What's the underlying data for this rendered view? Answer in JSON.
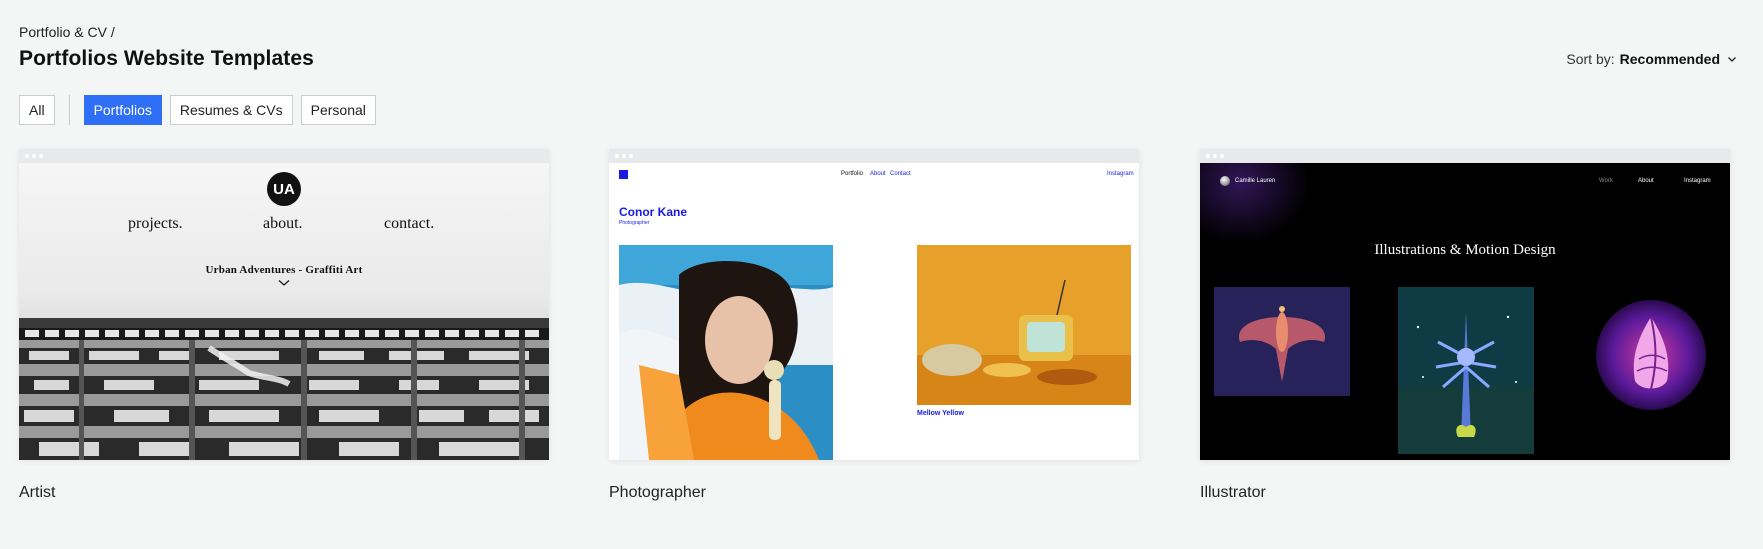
{
  "breadcrumb": {
    "parent": "Portfolio & CV",
    "separator": "/"
  },
  "page": {
    "title": "Portfolios Website Templates"
  },
  "sort": {
    "label": "Sort by:",
    "value": "Recommended"
  },
  "filters": [
    {
      "label": "All",
      "active": false
    },
    {
      "label": "Portfolios",
      "active": true
    },
    {
      "label": "Resumes & CVs",
      "active": false
    },
    {
      "label": "Personal",
      "active": false
    }
  ],
  "colors": {
    "accent": "#2f6ff5",
    "background": "#f4f5f5",
    "photographer_blue": "#1a1ae0"
  },
  "templates": [
    {
      "name": "Artist",
      "preview": {
        "logo": "UA",
        "nav": [
          "projects.",
          "about.",
          "contact."
        ],
        "subtitle": "Urban Adventures - Graffiti Art"
      }
    },
    {
      "name": "Photographer",
      "preview": {
        "nav": [
          "Portfolio",
          "About",
          "Contact"
        ],
        "social": "Instagram",
        "heading": "Conor Kane",
        "role": "Photographer",
        "caption": "Mellow Yellow"
      }
    },
    {
      "name": "Illustrator",
      "preview": {
        "author": "Camille Lauren",
        "nav": [
          "Work",
          "About",
          "Instagram"
        ],
        "heading": "Illustrations & Motion Design"
      }
    }
  ]
}
